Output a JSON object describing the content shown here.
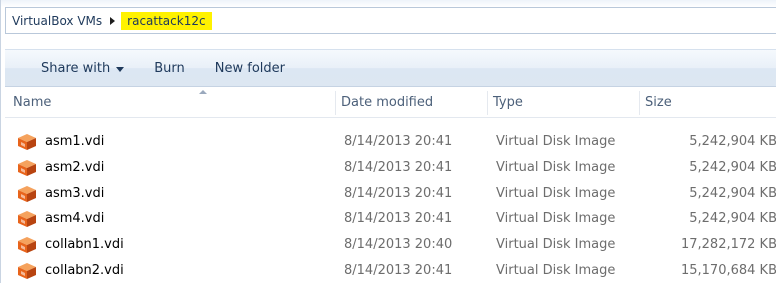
{
  "address": {
    "crumbs": [
      "VirtualBox VMs",
      "racattack12c"
    ]
  },
  "toolbar": {
    "share_label": "Share with",
    "burn_label": "Burn",
    "new_folder_label": "New folder"
  },
  "columns": {
    "name": "Name",
    "date": "Date modified",
    "type": "Type",
    "size": "Size"
  },
  "files": [
    {
      "name": "asm1.vdi",
      "date": "8/14/2013 20:41",
      "type": "Virtual Disk Image",
      "size": "5,242,904 KB",
      "icon": "vbox-disk-icon"
    },
    {
      "name": "asm2.vdi",
      "date": "8/14/2013 20:41",
      "type": "Virtual Disk Image",
      "size": "5,242,904 KB",
      "icon": "vbox-disk-icon"
    },
    {
      "name": "asm3.vdi",
      "date": "8/14/2013 20:41",
      "type": "Virtual Disk Image",
      "size": "5,242,904 KB",
      "icon": "vbox-disk-icon"
    },
    {
      "name": "asm4.vdi",
      "date": "8/14/2013 20:41",
      "type": "Virtual Disk Image",
      "size": "5,242,904 KB",
      "icon": "vbox-disk-icon"
    },
    {
      "name": "collabn1.vdi",
      "date": "8/14/2013 20:40",
      "type": "Virtual Disk Image",
      "size": "17,282,172 KB",
      "icon": "vbox-disk-icon"
    },
    {
      "name": "collabn2.vdi",
      "date": "8/14/2013 20:41",
      "type": "Virtual Disk Image",
      "size": "15,170,684 KB",
      "icon": "vbox-disk-icon"
    }
  ],
  "colors": {
    "highlight": "#fff200",
    "text": "#1e395b",
    "icon_orange": "#e8641b"
  }
}
